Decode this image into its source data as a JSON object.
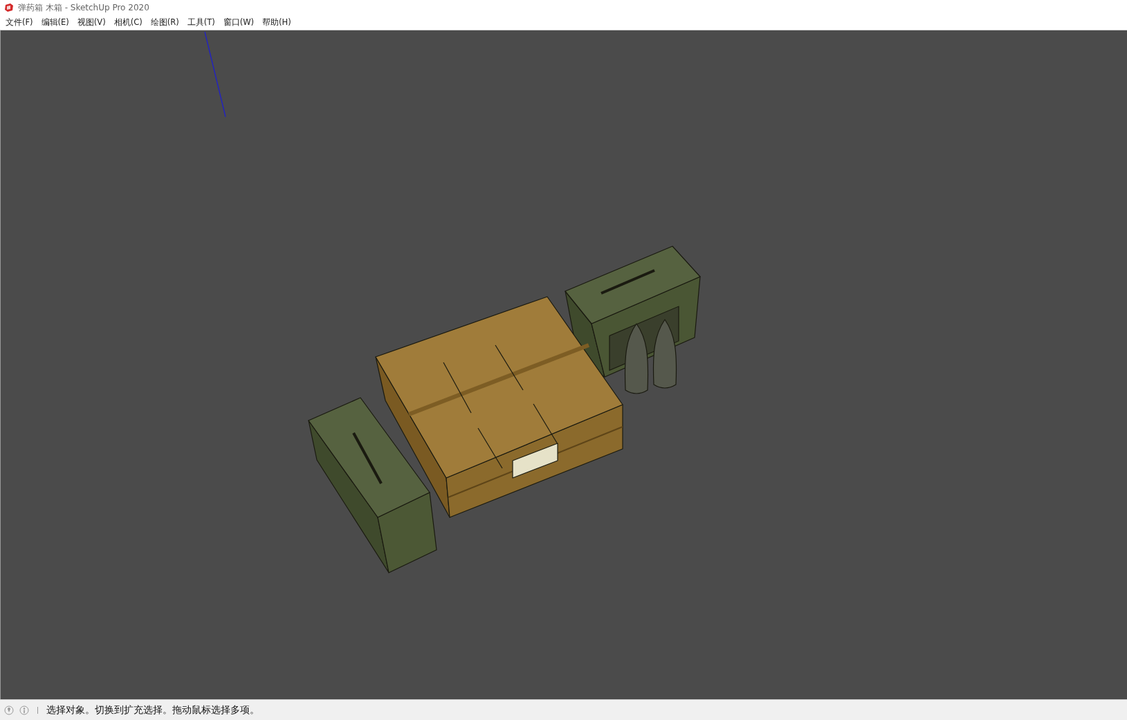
{
  "window": {
    "title": "弹药箱 木箱 - SketchUp Pro 2020"
  },
  "menu": [
    "文件(F)",
    "编辑(E)",
    "视图(V)",
    "相机(C)",
    "绘图(R)",
    "工具(T)",
    "窗口(W)",
    "帮助(H)"
  ],
  "status_bar": {
    "text": "选择对象。切换到扩充选择。拖动鼠标选择多项。"
  }
}
